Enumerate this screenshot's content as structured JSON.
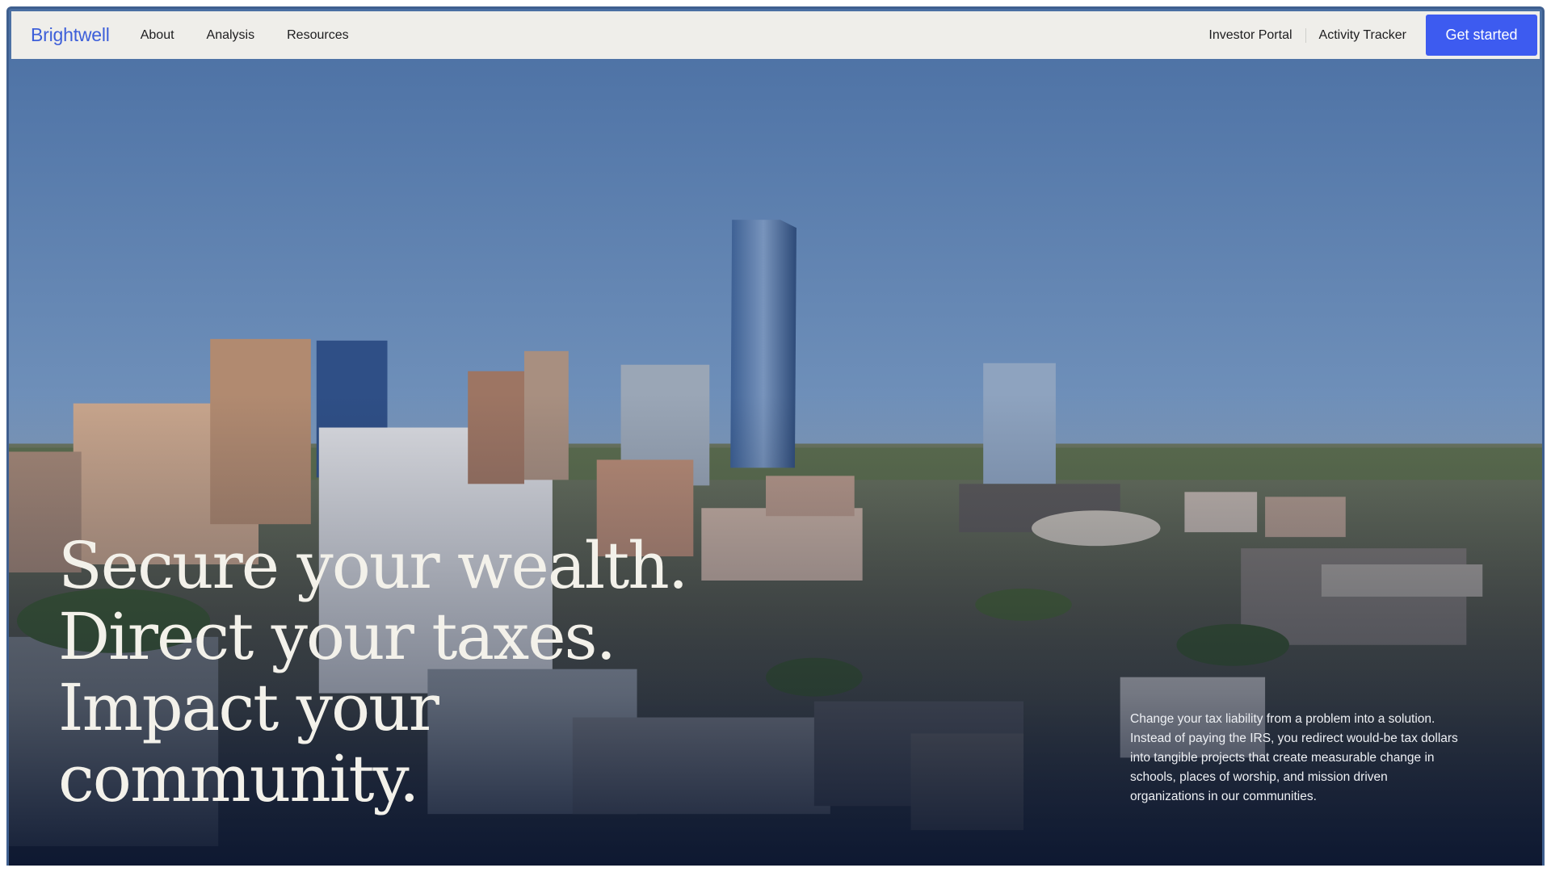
{
  "nav": {
    "brand": "Brightwell",
    "links": [
      "About",
      "Analysis",
      "Resources"
    ],
    "right_links": [
      "Investor Portal",
      "Activity Tracker"
    ],
    "cta_label": "Get started"
  },
  "hero": {
    "headline_lines": [
      "Secure your wealth.",
      "Direct your taxes.",
      "Impact your",
      "community."
    ],
    "description": "Change your tax liability from a problem into a solution. Instead of paying the IRS, you redirect would-be tax dollars into tangible projects that create measurable change in schools, places of worship, and mission driven organizations in our communities.",
    "background": "aerial-city-skyline-photo"
  },
  "colors": {
    "brand": "#3d5fd9",
    "cta": "#3d5bf0",
    "nav_bg": "#efeeea",
    "sky": "#4e74a8",
    "headline": "#f3f1ea"
  }
}
